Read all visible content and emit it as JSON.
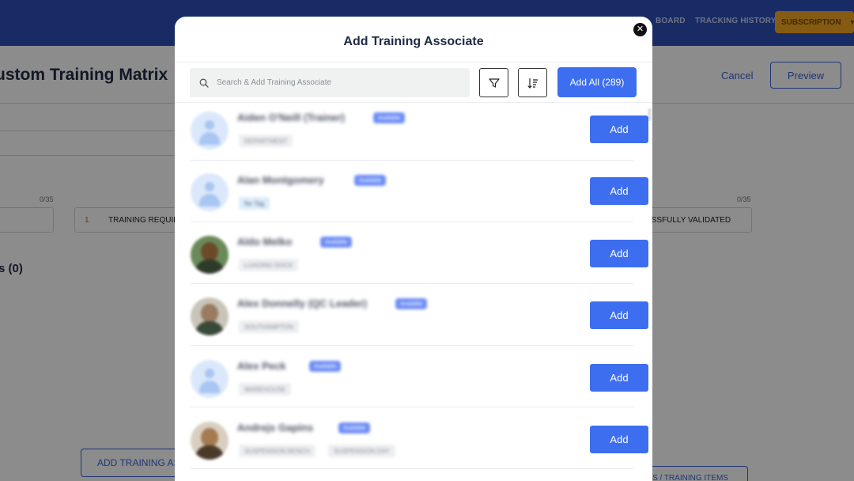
{
  "background": {
    "nav_items": [
      "BOARD",
      "TRACKING HISTORY"
    ],
    "subscription_label": "SUBSCRIPTION",
    "page_title": "ustom Training Matrix",
    "cancel_label": "Cancel",
    "preview_label": "Preview",
    "count_left": "0/35",
    "count_right": "0/35",
    "step_number": "1",
    "step_label_training": "TRAINING REQUIR",
    "step_label_validated": "ESSFULLY VALIDATED",
    "section_title": "s (0)",
    "add_training_associate_button": "ADD TRAINING ASSO",
    "training_items_button": "S / TRAINING ITEMS"
  },
  "modal": {
    "title": "Add Training Associate",
    "search_placeholder": "Search & Add Training Associate",
    "add_all_label": "Add All (289)",
    "add_label": "Add",
    "associates": [
      {
        "name": "Aiden O'Neill (Trainer)",
        "status": "Available",
        "tags": [
          "DEPARTMENT"
        ],
        "avatar": "default"
      },
      {
        "name": "Alan Montgomery",
        "status": "Available",
        "tags": [
          "No Tag"
        ],
        "avatar": "default"
      },
      {
        "name": "Aldo Melko",
        "status": "Available",
        "tags": [
          "LOADING DOCK"
        ],
        "avatar": "photo"
      },
      {
        "name": "Alex Donnelly (QC Leader)",
        "status": "Available",
        "tags": [
          "SOUTHAMPTON"
        ],
        "avatar": "photo"
      },
      {
        "name": "Alex Peck",
        "status": "Available",
        "tags": [
          "WAREHOUSE"
        ],
        "avatar": "default"
      },
      {
        "name": "Andrejs Gapins",
        "status": "Available",
        "tags": [
          "SUSPENSION BENCH",
          "SUSPENSION DAY"
        ],
        "avatar": "photo"
      }
    ]
  },
  "colors": {
    "primary": "#3d6ef0",
    "topbar": "#2c4fb8",
    "subscription": "#f2a623",
    "status_badge": "#6f8ef5"
  },
  "icons": {
    "search": "search-icon",
    "filter": "filter-icon",
    "sort": "sort-icon",
    "close": "close-icon"
  }
}
